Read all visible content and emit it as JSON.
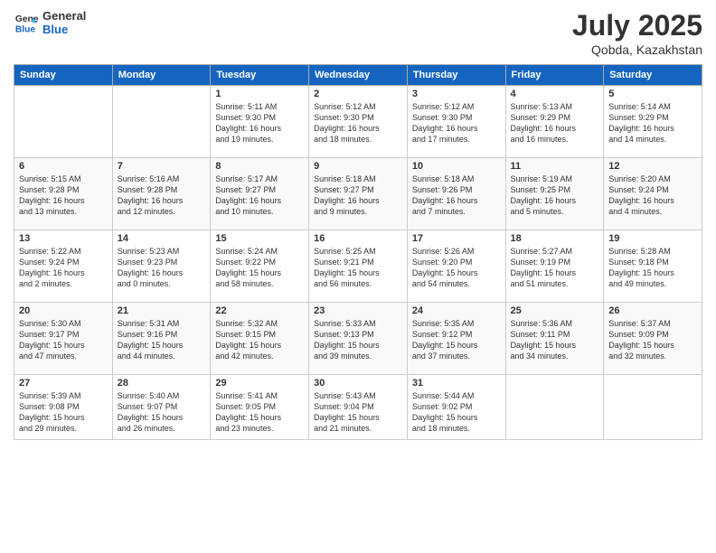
{
  "logo": {
    "general": "General",
    "blue": "Blue"
  },
  "title": {
    "month": "July 2025",
    "location": "Qobda, Kazakhstan"
  },
  "headers": [
    "Sunday",
    "Monday",
    "Tuesday",
    "Wednesday",
    "Thursday",
    "Friday",
    "Saturday"
  ],
  "weeks": [
    [
      {
        "day": "",
        "info": ""
      },
      {
        "day": "",
        "info": ""
      },
      {
        "day": "1",
        "info": "Sunrise: 5:11 AM\nSunset: 9:30 PM\nDaylight: 16 hours\nand 19 minutes."
      },
      {
        "day": "2",
        "info": "Sunrise: 5:12 AM\nSunset: 9:30 PM\nDaylight: 16 hours\nand 18 minutes."
      },
      {
        "day": "3",
        "info": "Sunrise: 5:12 AM\nSunset: 9:30 PM\nDaylight: 16 hours\nand 17 minutes."
      },
      {
        "day": "4",
        "info": "Sunrise: 5:13 AM\nSunset: 9:29 PM\nDaylight: 16 hours\nand 16 minutes."
      },
      {
        "day": "5",
        "info": "Sunrise: 5:14 AM\nSunset: 9:29 PM\nDaylight: 16 hours\nand 14 minutes."
      }
    ],
    [
      {
        "day": "6",
        "info": "Sunrise: 5:15 AM\nSunset: 9:28 PM\nDaylight: 16 hours\nand 13 minutes."
      },
      {
        "day": "7",
        "info": "Sunrise: 5:16 AM\nSunset: 9:28 PM\nDaylight: 16 hours\nand 12 minutes."
      },
      {
        "day": "8",
        "info": "Sunrise: 5:17 AM\nSunset: 9:27 PM\nDaylight: 16 hours\nand 10 minutes."
      },
      {
        "day": "9",
        "info": "Sunrise: 5:18 AM\nSunset: 9:27 PM\nDaylight: 16 hours\nand 9 minutes."
      },
      {
        "day": "10",
        "info": "Sunrise: 5:18 AM\nSunset: 9:26 PM\nDaylight: 16 hours\nand 7 minutes."
      },
      {
        "day": "11",
        "info": "Sunrise: 5:19 AM\nSunset: 9:25 PM\nDaylight: 16 hours\nand 5 minutes."
      },
      {
        "day": "12",
        "info": "Sunrise: 5:20 AM\nSunset: 9:24 PM\nDaylight: 16 hours\nand 4 minutes."
      }
    ],
    [
      {
        "day": "13",
        "info": "Sunrise: 5:22 AM\nSunset: 9:24 PM\nDaylight: 16 hours\nand 2 minutes."
      },
      {
        "day": "14",
        "info": "Sunrise: 5:23 AM\nSunset: 9:23 PM\nDaylight: 16 hours\nand 0 minutes."
      },
      {
        "day": "15",
        "info": "Sunrise: 5:24 AM\nSunset: 9:22 PM\nDaylight: 15 hours\nand 58 minutes."
      },
      {
        "day": "16",
        "info": "Sunrise: 5:25 AM\nSunset: 9:21 PM\nDaylight: 15 hours\nand 56 minutes."
      },
      {
        "day": "17",
        "info": "Sunrise: 5:26 AM\nSunset: 9:20 PM\nDaylight: 15 hours\nand 54 minutes."
      },
      {
        "day": "18",
        "info": "Sunrise: 5:27 AM\nSunset: 9:19 PM\nDaylight: 15 hours\nand 51 minutes."
      },
      {
        "day": "19",
        "info": "Sunrise: 5:28 AM\nSunset: 9:18 PM\nDaylight: 15 hours\nand 49 minutes."
      }
    ],
    [
      {
        "day": "20",
        "info": "Sunrise: 5:30 AM\nSunset: 9:17 PM\nDaylight: 15 hours\nand 47 minutes."
      },
      {
        "day": "21",
        "info": "Sunrise: 5:31 AM\nSunset: 9:16 PM\nDaylight: 15 hours\nand 44 minutes."
      },
      {
        "day": "22",
        "info": "Sunrise: 5:32 AM\nSunset: 9:15 PM\nDaylight: 15 hours\nand 42 minutes."
      },
      {
        "day": "23",
        "info": "Sunrise: 5:33 AM\nSunset: 9:13 PM\nDaylight: 15 hours\nand 39 minutes."
      },
      {
        "day": "24",
        "info": "Sunrise: 5:35 AM\nSunset: 9:12 PM\nDaylight: 15 hours\nand 37 minutes."
      },
      {
        "day": "25",
        "info": "Sunrise: 5:36 AM\nSunset: 9:11 PM\nDaylight: 15 hours\nand 34 minutes."
      },
      {
        "day": "26",
        "info": "Sunrise: 5:37 AM\nSunset: 9:09 PM\nDaylight: 15 hours\nand 32 minutes."
      }
    ],
    [
      {
        "day": "27",
        "info": "Sunrise: 5:39 AM\nSunset: 9:08 PM\nDaylight: 15 hours\nand 29 minutes."
      },
      {
        "day": "28",
        "info": "Sunrise: 5:40 AM\nSunset: 9:07 PM\nDaylight: 15 hours\nand 26 minutes."
      },
      {
        "day": "29",
        "info": "Sunrise: 5:41 AM\nSunset: 9:05 PM\nDaylight: 15 hours\nand 23 minutes."
      },
      {
        "day": "30",
        "info": "Sunrise: 5:43 AM\nSunset: 9:04 PM\nDaylight: 15 hours\nand 21 minutes."
      },
      {
        "day": "31",
        "info": "Sunrise: 5:44 AM\nSunset: 9:02 PM\nDaylight: 15 hours\nand 18 minutes."
      },
      {
        "day": "",
        "info": ""
      },
      {
        "day": "",
        "info": ""
      }
    ]
  ]
}
